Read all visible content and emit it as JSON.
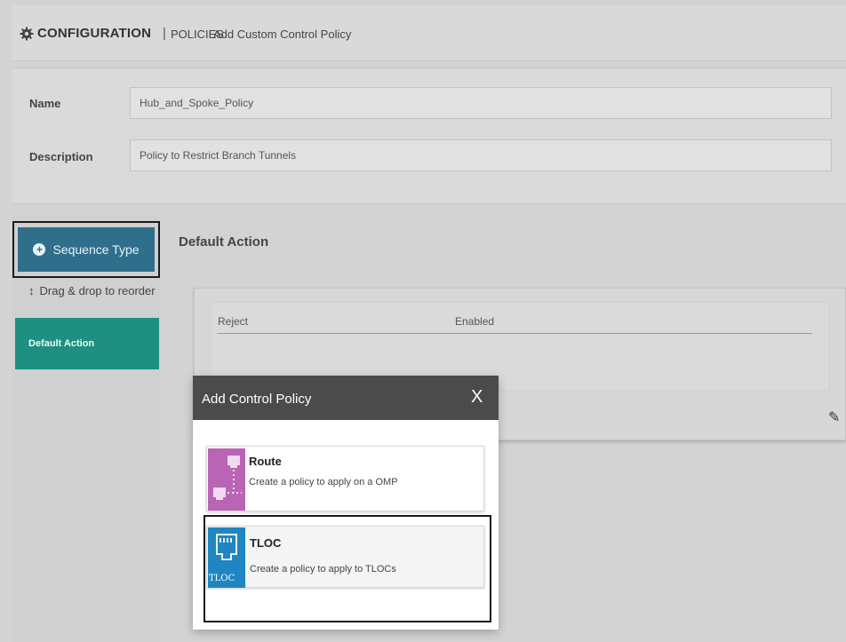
{
  "header": {
    "section": "CONFIGURATION",
    "separator": "|",
    "page": "POLICIES",
    "subtitle": "Add Custom Control Policy",
    "icon": "gear-icon"
  },
  "form": {
    "name_label": "Name",
    "name_value": "Hub_and_Spoke_Policy",
    "description_label": "Description",
    "description_value": "Policy to Restrict Branch Tunnels"
  },
  "sidebar": {
    "sequence_button": "Sequence Type",
    "drag_hint": "Drag & drop to reorder",
    "items": [
      {
        "label": "Default Action"
      }
    ]
  },
  "main": {
    "title": "Default Action",
    "row": {
      "action": "Reject",
      "status": "Enabled"
    }
  },
  "modal": {
    "title": "Add Control Policy",
    "close": "X",
    "options": [
      {
        "title": "Route",
        "description": "Create a policy to apply on a OMP",
        "icon": "route-icon"
      },
      {
        "title": "TLOC",
        "description": "Create a policy to apply to TLOCs",
        "icon": "tloc-icon",
        "icon_text": "TLOC"
      }
    ]
  },
  "colors": {
    "sequence_button": "#2f6f8c",
    "active_item": "#1e8f80",
    "modal_header": "#4b4b4b",
    "route_icon": "#b964b4",
    "tloc_icon": "#1f86c1"
  }
}
